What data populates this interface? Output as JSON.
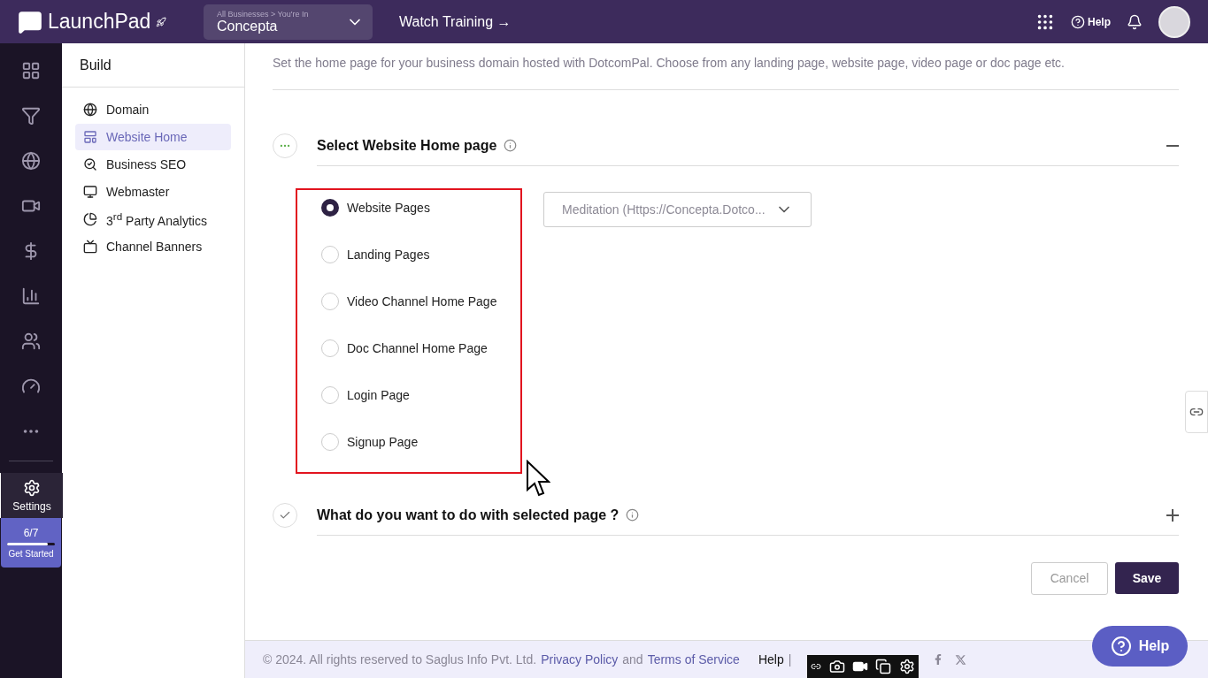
{
  "header": {
    "brand": "LaunchPad",
    "business_path": "All Businesses > You're In",
    "business": "Concepta",
    "watch_training": "Watch Training →",
    "help": "Help"
  },
  "rail": {
    "items": [
      {
        "kind": "grid"
      },
      {
        "kind": "funnel"
      },
      {
        "kind": "globe"
      },
      {
        "kind": "video"
      },
      {
        "kind": "dollar"
      },
      {
        "kind": "chart"
      },
      {
        "kind": "people"
      },
      {
        "kind": "gauge"
      },
      {
        "kind": "more"
      }
    ],
    "settings": {
      "label": "Settings",
      "selected": true
    },
    "get_started": {
      "count": "6/7",
      "level": 0.85,
      "label": "Get Started"
    }
  },
  "sidebar": {
    "title": "Build",
    "items": [
      {
        "kind": "globe",
        "label": "Domain",
        "selected": false
      },
      {
        "kind": "layout",
        "label": "Website Home",
        "selected": true
      },
      {
        "kind": "search",
        "label": "Business SEO",
        "selected": false
      },
      {
        "kind": "monitor",
        "label": "Webmaster",
        "selected": false
      },
      {
        "kind": "pie",
        "label": "3$^{rd}$ Party Analytics",
        "selected": false
      },
      {
        "kind": "tv",
        "label": "Channel Banners",
        "selected": false
      }
    ]
  },
  "page": {
    "description": "Set the home page for your business domain hosted with DotcomPal. Choose from any landing page, website page, video page or doc page etc."
  },
  "sections": [
    {
      "title": "Select Website Home page",
      "done": false,
      "expanded": true,
      "options": [
        {
          "label": "Website Pages",
          "selected": true
        },
        {
          "label": "Landing Pages",
          "selected": false
        },
        {
          "label": "Video Channel Home Page",
          "selected": false
        },
        {
          "label": "Doc Channel Home Page",
          "selected": false
        },
        {
          "label": "Login Page",
          "selected": false
        },
        {
          "label": "Signup Page",
          "selected": false
        }
      ],
      "dropdown": {
        "value": "Meditation (Https://Concepta.Dotco..."
      }
    },
    {
      "title": "What do you want to do with selected page ?",
      "done": true,
      "expanded": false
    }
  ],
  "buttons": {
    "cancel": "Cancel",
    "save": "Save"
  },
  "footer": {
    "copyright": "©  2024. All rights reserved to Saglus Info Pvt. Ltd.",
    "privacy": "Privacy Policy",
    "and": "and",
    "terms": "Terms of Service",
    "help": "Help",
    "separator": "|"
  },
  "help_button": "Help"
}
